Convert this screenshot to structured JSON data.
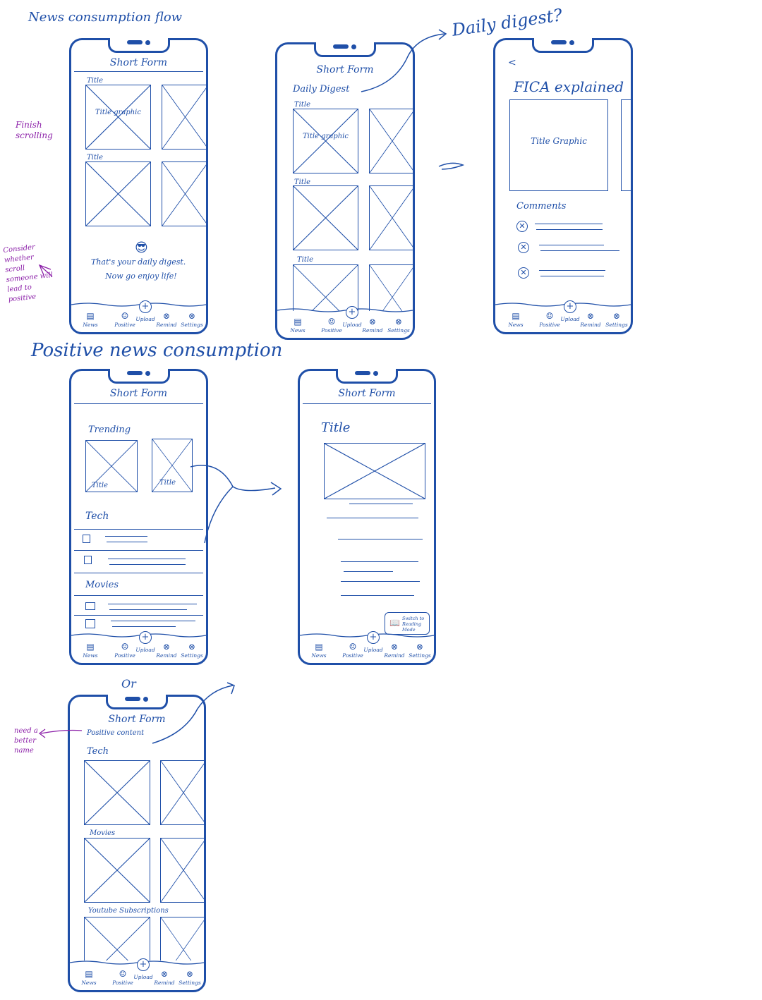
{
  "sections": {
    "news_flow": "News consumption flow",
    "positive_flow": "Positive news consumption",
    "or_label": "Or"
  },
  "annotations": {
    "daily_digest_question": "Daily digest?",
    "finish_scrolling": "Finish scrolling",
    "consider_whether": "Consider whether scroll someone will lead to positive",
    "need_better_name": "need a better name"
  },
  "app_title": "Short Form",
  "tabs": [
    "News",
    "Positive",
    "Upload",
    "Remind",
    "Settings"
  ],
  "colors": {
    "ink": "#1f4fa8",
    "note": "#8b1fa8"
  },
  "screen1": {
    "tile_label": "Title",
    "tile_caption": "Title graphic",
    "emoji": "😎",
    "end_message_1": "That's your daily digest.",
    "end_message_2": "Now go enjoy life!"
  },
  "screen2": {
    "header": "Daily Digest",
    "tile_label": "Title",
    "tile_caption": "Title graphic"
  },
  "screen3": {
    "back": "<",
    "title": "FICA explained",
    "graphic_caption": "Title Graphic",
    "comments": "Comments"
  },
  "screen4": {
    "trending": "Trending",
    "card_title": "Title",
    "tech": "Tech",
    "movies": "Movies"
  },
  "screen5": {
    "title": "Title",
    "reading_mode": "Switch to Reading Mode"
  },
  "screen6": {
    "subtitle": "Positive content",
    "tech": "Tech",
    "movies": "Movies",
    "youtube": "Youtube Subscriptions"
  }
}
